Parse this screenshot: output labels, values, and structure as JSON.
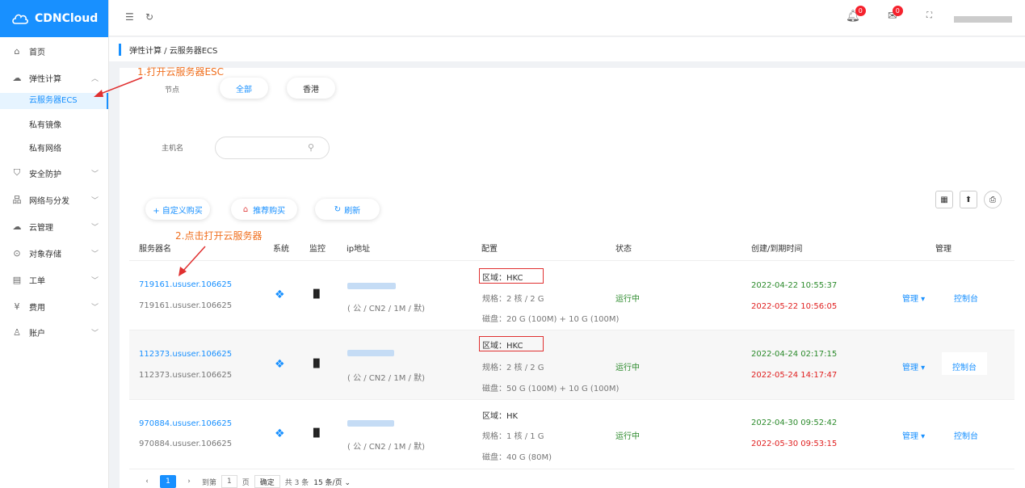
{
  "brand": "CDNCloud",
  "sidebar": {
    "items": [
      {
        "label": "首页",
        "icon": "home-icon",
        "chev": ""
      },
      {
        "label": "弹性计算",
        "icon": "cloud-icon",
        "chev": "︿"
      },
      {
        "label": "安全防护",
        "icon": "shield-icon",
        "chev": "﹀"
      },
      {
        "label": "网络与分发",
        "icon": "network-icon",
        "chev": "﹀"
      },
      {
        "label": "云管理",
        "icon": "cloud-manage-icon",
        "chev": "﹀"
      },
      {
        "label": "对象存储",
        "icon": "storage-icon",
        "chev": "﹀"
      },
      {
        "label": "工单",
        "icon": "ticket-icon",
        "chev": "﹀"
      },
      {
        "label": "费用",
        "icon": "yen-icon",
        "chev": "﹀"
      },
      {
        "label": "账户",
        "icon": "user-icon",
        "chev": "﹀"
      }
    ],
    "sub": [
      "云服务器ECS",
      "私有镜像",
      "私有网络"
    ]
  },
  "header": {
    "notif_count": "0",
    "mail_count": "0"
  },
  "breadcrumb": "弹性计算 / 云服务器ECS",
  "annotations": {
    "step1": "1.打开云服务器ESC",
    "step2": "2.点击打开云服务器"
  },
  "filters": {
    "node_label": "节点",
    "node_all": "全部",
    "node_hk": "香港",
    "host_label": "主机名"
  },
  "toolbar": {
    "custom": "+ 自定义购买",
    "recommend": "推荐购买",
    "refresh": "刷新"
  },
  "table": {
    "headers": [
      "服务器名",
      "系统",
      "监控",
      "ip地址",
      "配置",
      "状态",
      "创建/到期时间",
      "管理"
    ],
    "rows": [
      {
        "name": "719161.ususer.106625",
        "sub": "719161.ususer.106625",
        "ip": "( 公 / CN2 / 1M / 默)",
        "region": "区域：HKC",
        "spec": "规格：2 核 / 2 G",
        "disk": "磁盘：20 G (100M) + 10 G (100M)",
        "status": "运行中",
        "created": "2022-04-22 10:55:37",
        "expire": "2022-05-22 10:56:05",
        "manage": "管理 ▾",
        "console": "控制台"
      },
      {
        "name": "112373.ususer.106625",
        "sub": "112373.ususer.106625",
        "ip": "( 公 / CN2 / 1M / 默)",
        "region": "区域：HKC",
        "spec": "规格：2 核 / 2 G",
        "disk": "磁盘：50 G (100M) + 10 G (100M)",
        "status": "运行中",
        "created": "2022-04-24 02:17:15",
        "expire": "2022-05-24 14:17:47",
        "manage": "管理 ▾",
        "console": "控制台"
      },
      {
        "name": "970884.ususer.106625",
        "sub": "970884.ususer.106625",
        "ip": "( 公 / CN2 / 1M / 默)",
        "region": "区域：HK",
        "spec": "规格：1 核 / 1 G",
        "disk": "磁盘：40 G (80M)",
        "status": "运行中",
        "created": "2022-04-30 09:52:42",
        "expire": "2022-05-30 09:53:15",
        "manage": "管理 ▾",
        "console": "控制台"
      }
    ]
  },
  "pager": {
    "page": "1",
    "goto": "到第",
    "page_input": "1",
    "page_unit": "页",
    "confirm": "确定",
    "total": "共 3 条",
    "size": "15 条/页"
  }
}
